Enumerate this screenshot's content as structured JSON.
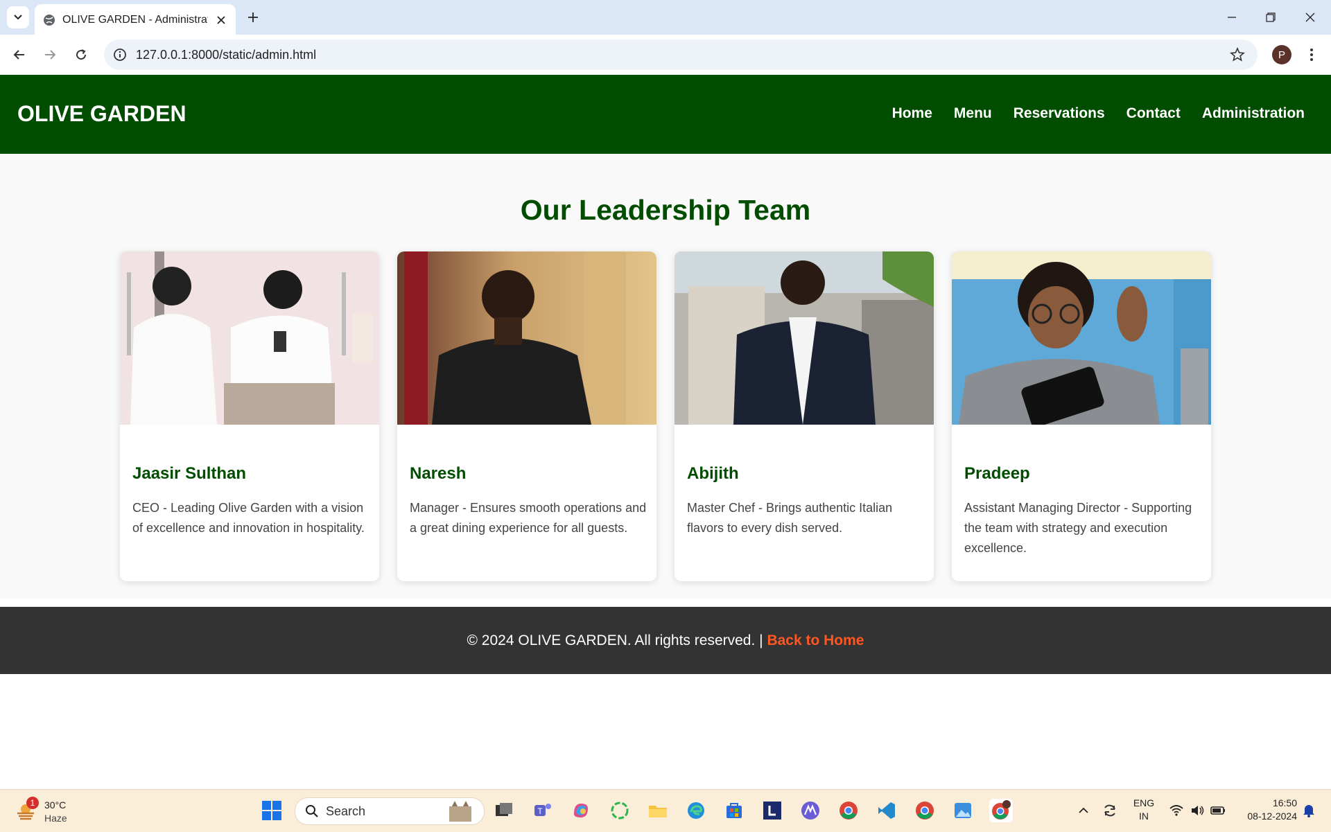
{
  "browser": {
    "tab_title": "OLIVE GARDEN - Administration",
    "url": "127.0.0.1:8000/static/admin.html",
    "profile_initial": "P"
  },
  "site": {
    "logo": "OLIVE GARDEN",
    "nav": [
      "Home",
      "Menu",
      "Reservations",
      "Contact",
      "Administration"
    ],
    "section_title": "Our Leadership Team",
    "team": [
      {
        "name": "Jaasir Sulthan",
        "desc": "CEO - Leading Olive Garden with a vision of excellence and innovation in hospitality."
      },
      {
        "name": "Naresh",
        "desc": "Manager - Ensures smooth operations and a great dining experience for all guests."
      },
      {
        "name": "Abijith",
        "desc": "Master Chef - Brings authentic Italian flavors to every dish served."
      },
      {
        "name": "Pradeep",
        "desc": "Assistant Managing Director - Supporting the team with strategy and execution excellence."
      }
    ],
    "footer": {
      "copyright": "© 2024 OLIVE GARDEN. All rights reserved. |",
      "link": "Back to Home"
    },
    "colors": {
      "brand": "#004d00",
      "footer_bg": "#333333",
      "footer_link": "#ff5722"
    }
  },
  "taskbar": {
    "weather": {
      "badge": "1",
      "temp": "30°C",
      "condition": "Haze"
    },
    "search_placeholder": "Search",
    "apps": [
      "start-icon",
      "search",
      "file-explorer-icon",
      "teams-icon",
      "copilot-icon",
      "refresh-app-icon",
      "folder-icon",
      "edge-icon",
      "store-icon",
      "l-app-icon",
      "vpn-app-icon",
      "chrome-icon",
      "vscode-icon",
      "chrome-icon",
      "photos-icon",
      "chrome-profile-icon"
    ],
    "lang": {
      "line1": "ENG",
      "line2": "IN"
    },
    "clock": {
      "time": "16:50",
      "date": "08-12-2024"
    }
  }
}
